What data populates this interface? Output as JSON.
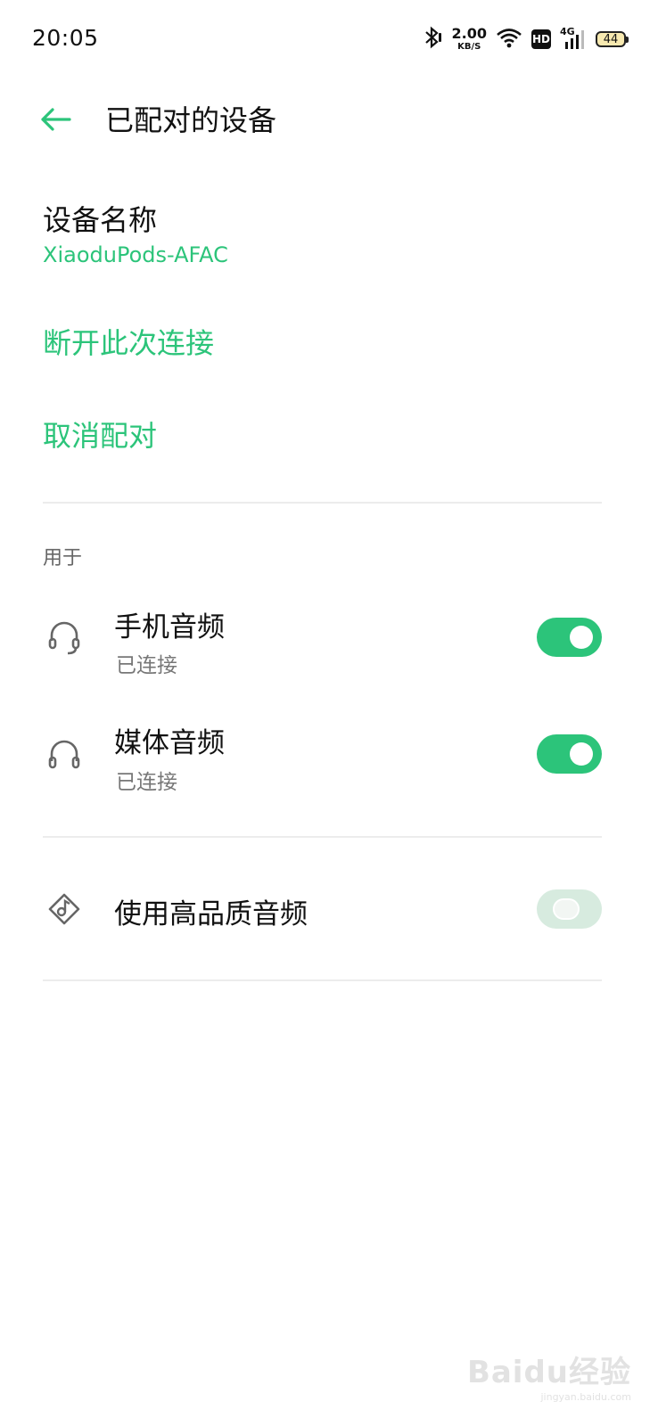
{
  "status_bar": {
    "time": "20:05",
    "speed_value": "2.00",
    "speed_unit": "KB/S",
    "hd": "HD",
    "network": "4G",
    "battery": "44"
  },
  "header": {
    "title": "已配对的设备"
  },
  "device": {
    "label": "设备名称",
    "name": "XiaoduPods-AFAC"
  },
  "actions": {
    "disconnect": "断开此次连接",
    "unpair": "取消配对"
  },
  "usage": {
    "section_title": "用于",
    "items": [
      {
        "title": "手机音频",
        "status": "已连接",
        "enabled": true,
        "icon": "headset-mic-icon"
      },
      {
        "title": "媒体音频",
        "status": "已连接",
        "enabled": true,
        "icon": "headphones-icon"
      }
    ]
  },
  "hq_audio": {
    "title": "使用高品质音频",
    "enabled": false,
    "icon": "music-note-diamond-icon"
  },
  "watermark": {
    "text": "Baidu经验",
    "sub": "jingyan.baidu.com"
  },
  "colors": {
    "accent": "#2cc47a",
    "toggle_disabled": "#d7ebdf"
  }
}
